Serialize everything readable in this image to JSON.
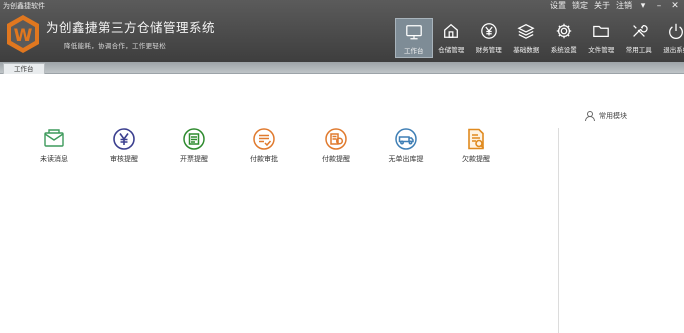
{
  "window": {
    "title": "为创鑫捷软件"
  },
  "window_controls": {
    "settings": "设置",
    "lock": "锁定",
    "about": "关于",
    "logout": "注销"
  },
  "brand": {
    "logo_letter": "W",
    "title": "为创鑫捷第三方仓储管理系统",
    "slogan": "降低能耗，协调合作，工作更轻松"
  },
  "nav": [
    {
      "label": "工作台",
      "icon": "monitor-icon",
      "active": true
    },
    {
      "label": "仓储管理",
      "icon": "warehouse-icon"
    },
    {
      "label": "财务管理",
      "icon": "yen-icon"
    },
    {
      "label": "基础数据",
      "icon": "layers-icon"
    },
    {
      "label": "系统设置",
      "icon": "gear-icon"
    },
    {
      "label": "文件管理",
      "icon": "folder-icon"
    },
    {
      "label": "常用工具",
      "icon": "tools-icon"
    },
    {
      "label": "退出系统",
      "icon": "power-icon"
    }
  ],
  "tabs": [
    {
      "label": "工作台"
    }
  ],
  "quick_items": [
    {
      "label": "未读消息",
      "icon": "mail-icon",
      "color": "#3d9a5b"
    },
    {
      "label": "审核提醒",
      "icon": "yen-circle-icon",
      "color": "#3b3f8f"
    },
    {
      "label": "开票提醒",
      "icon": "invoice-icon",
      "color": "#2f8b2f"
    },
    {
      "label": "付款审批",
      "icon": "payment-approval-icon",
      "color": "#e07a2e"
    },
    {
      "label": "付款提醒",
      "icon": "payment-reminder-icon",
      "color": "#e07a2e"
    },
    {
      "label": "无单出库提",
      "icon": "truck-icon",
      "color": "#3f7fb5"
    },
    {
      "label": "欠款提醒",
      "icon": "debt-document-icon",
      "color": "#e08a1f"
    }
  ],
  "common_modules": {
    "label": "常用模块",
    "icon": "user-icon"
  }
}
